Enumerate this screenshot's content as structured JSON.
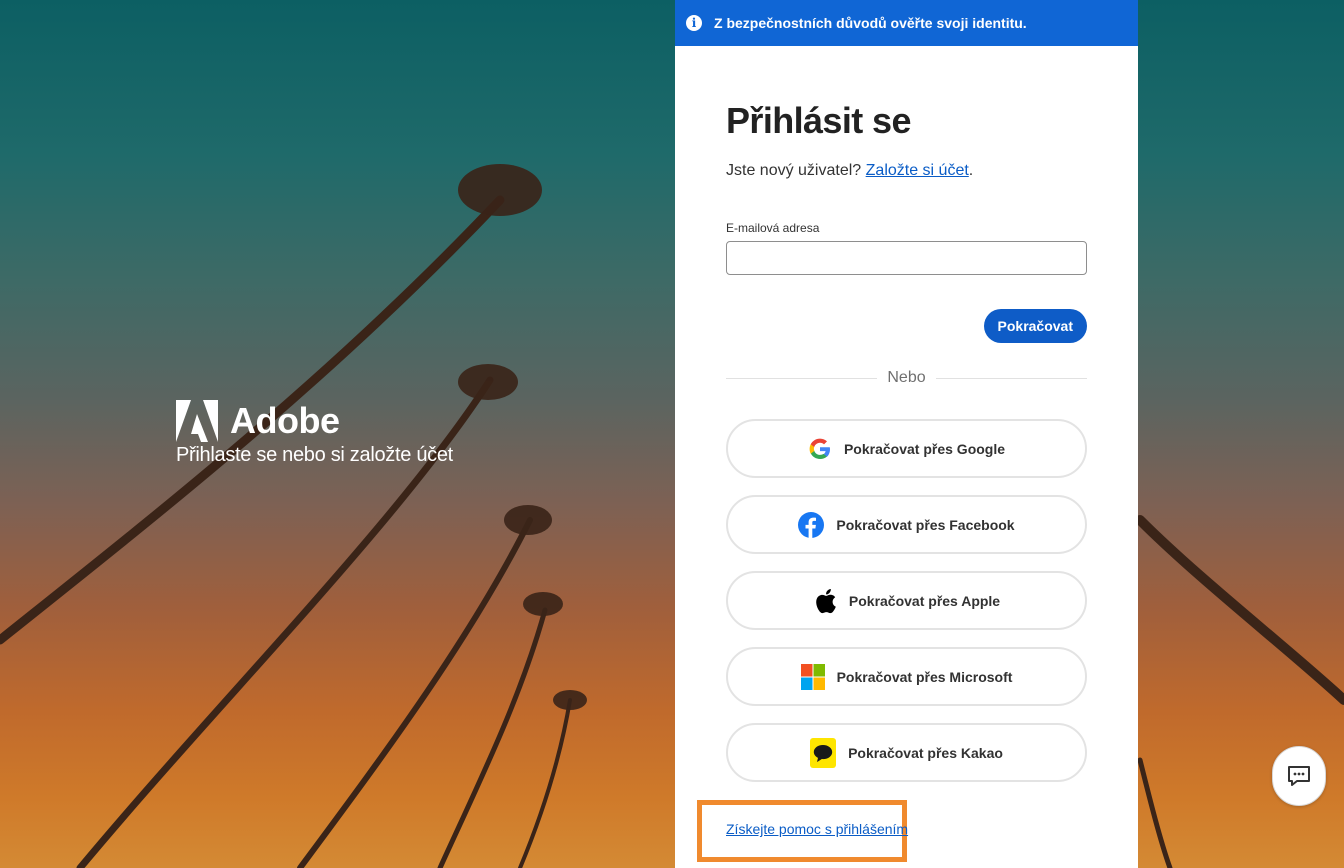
{
  "notice": {
    "text": "Z bezpečnostních důvodů ověřte svoji identitu."
  },
  "brand": {
    "name": "Adobe",
    "tagline": "Přihlaste se nebo si založte účet"
  },
  "signin": {
    "title": "Přihlásit se",
    "new_user_prompt": "Jste nový uživatel?",
    "create_account_link": "Založte si účet",
    "period": ".",
    "email_label": "E-mailová adresa",
    "email_value": "",
    "continue_button": "Pokračovat",
    "divider_text": "Nebo"
  },
  "social": [
    {
      "label": "Pokračovat přes Google",
      "icon": "google-icon"
    },
    {
      "label": "Pokračovat přes Facebook",
      "icon": "facebook-icon"
    },
    {
      "label": "Pokračovat přes Apple",
      "icon": "apple-icon"
    },
    {
      "label": "Pokračovat přes Microsoft",
      "icon": "microsoft-icon"
    },
    {
      "label": "Pokračovat přes Kakao",
      "icon": "kakao-icon"
    }
  ],
  "help": {
    "link_text": "Získejte pomoc s přihlášením"
  },
  "chat": {
    "icon": "chat-icon"
  },
  "colors": {
    "accent": "#1066d5",
    "highlight": "#f08a2e"
  }
}
